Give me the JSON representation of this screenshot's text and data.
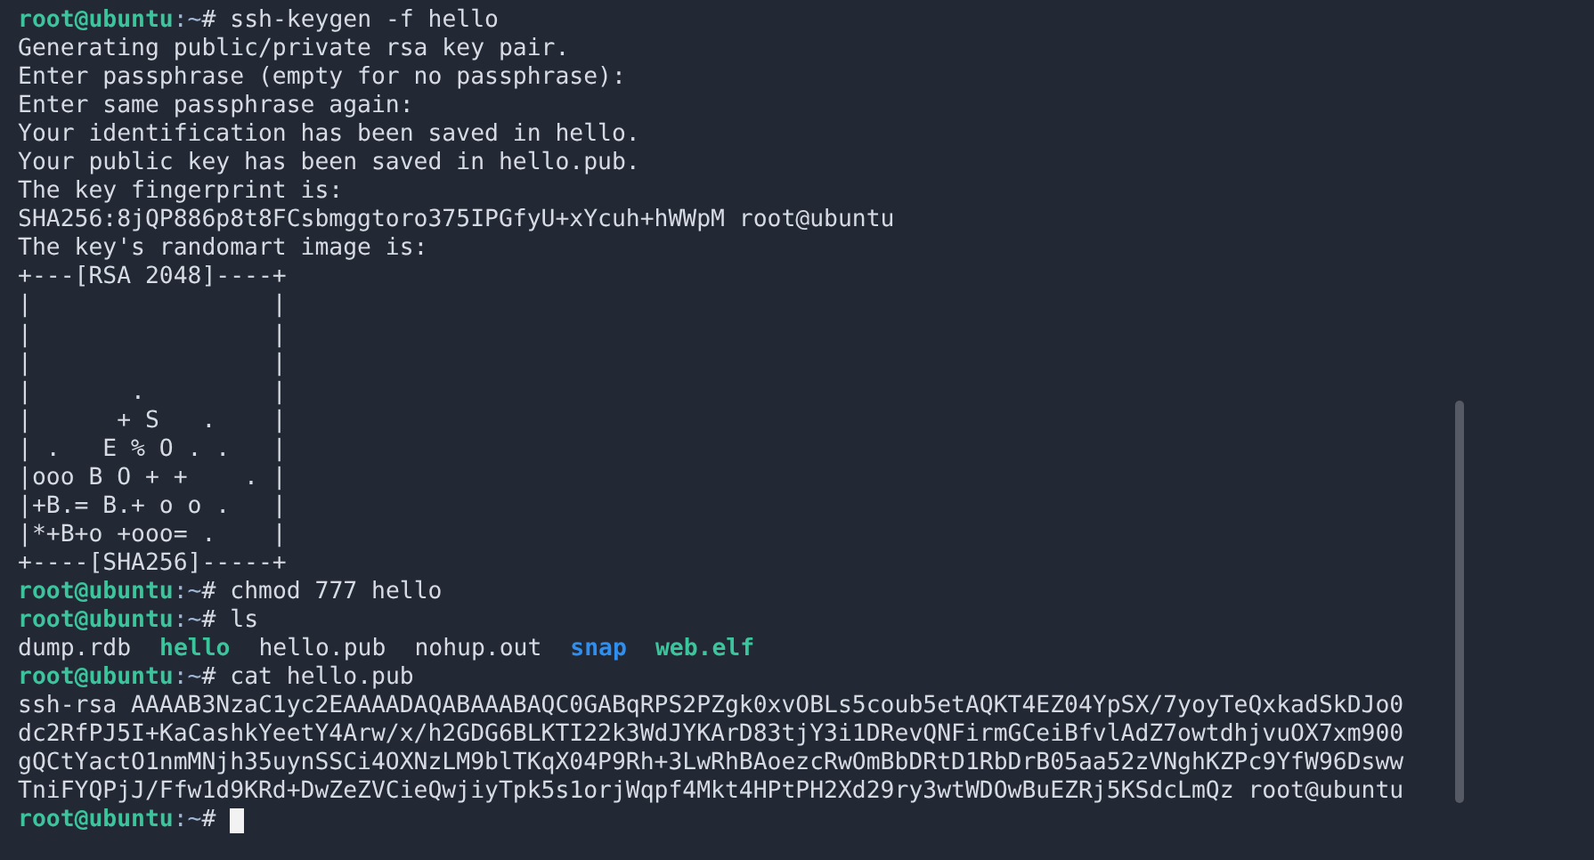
{
  "terminal": {
    "lines": [
      {
        "kind": "prompt",
        "user": "root@ubuntu",
        "path": ":~",
        "symbol": "#",
        "command": "ssh-keygen -f hello",
        "cursor": false
      },
      {
        "kind": "output",
        "text": "Generating public/private rsa key pair."
      },
      {
        "kind": "output",
        "text": "Enter passphrase (empty for no passphrase):"
      },
      {
        "kind": "output",
        "text": "Enter same passphrase again:"
      },
      {
        "kind": "output",
        "text": "Your identification has been saved in hello."
      },
      {
        "kind": "output",
        "text": "Your public key has been saved in hello.pub."
      },
      {
        "kind": "output",
        "text": "The key fingerprint is:"
      },
      {
        "kind": "output",
        "text": "SHA256:8jQP886p8t8FCsbmggtoro375IPGfyU+xYcuh+hWWpM root@ubuntu"
      },
      {
        "kind": "output",
        "text": "The key's randomart image is:"
      },
      {
        "kind": "output",
        "text": "+---[RSA 2048]----+"
      },
      {
        "kind": "output",
        "text": "|                 |"
      },
      {
        "kind": "output",
        "text": "|                 |"
      },
      {
        "kind": "output",
        "text": "|                 |"
      },
      {
        "kind": "output",
        "text": "|       .         |"
      },
      {
        "kind": "output",
        "text": "|      + S   .    |"
      },
      {
        "kind": "output",
        "text": "| .   E % O . .   |"
      },
      {
        "kind": "output",
        "text": "|ooo B O + +    . |"
      },
      {
        "kind": "output",
        "text": "|+B.= B.+ o o .   |"
      },
      {
        "kind": "output",
        "text": "|*+B+o +ooo= .    |"
      },
      {
        "kind": "output",
        "text": "+----[SHA256]-----+"
      },
      {
        "kind": "prompt",
        "user": "root@ubuntu",
        "path": ":~",
        "symbol": "#",
        "command": "chmod 777 hello",
        "cursor": false
      },
      {
        "kind": "prompt",
        "user": "root@ubuntu",
        "path": ":~",
        "symbol": "#",
        "command": "ls",
        "cursor": false
      },
      {
        "kind": "listing",
        "items": [
          {
            "name": "dump.rdb",
            "kind": "file"
          },
          {
            "name": "hello",
            "kind": "exec"
          },
          {
            "name": "hello.pub",
            "kind": "file"
          },
          {
            "name": "nohup.out",
            "kind": "file"
          },
          {
            "name": "snap",
            "kind": "dir"
          },
          {
            "name": "web.elf",
            "kind": "exec"
          }
        ]
      },
      {
        "kind": "prompt",
        "user": "root@ubuntu",
        "path": ":~",
        "symbol": "#",
        "command": "cat hello.pub",
        "cursor": false
      },
      {
        "kind": "output",
        "text": "ssh-rsa AAAAB3NzaC1yc2EAAAADAQABAAABAQC0GABqRPS2PZgk0xvOBLs5coub5etAQKT4EZ04YpSX/7yoyTeQxkadSkDJo0"
      },
      {
        "kind": "output",
        "text": "dc2RfPJ5I+KaCashkYeetY4Arw/x/h2GDG6BLKTI22k3WdJYKArD83tjY3i1DRevQNFirmGCeiBfvlAdZ7owtdhjvuOX7xm900"
      },
      {
        "kind": "output",
        "text": "gQCtYactO1nmMNjh35uynSSCi4OXNzLM9blTKqX04P9Rh+3LwRhBAoezcRwOmBbDRtD1RbDrB05aa52zVNghKZPc9YfW96Dsww"
      },
      {
        "kind": "output",
        "text": "TniFYQPjJ/Ffw1d9KRd+DwZeZVCieQwjiyTpk5s1orjWqpf4Mkt4HPtPH2Xd29ry3wtWDOwBuEZRj5KSdcLmQz root@ubuntu"
      },
      {
        "kind": "prompt",
        "user": "root@ubuntu",
        "path": ":~",
        "symbol": "#",
        "cursor": true
      }
    ]
  }
}
